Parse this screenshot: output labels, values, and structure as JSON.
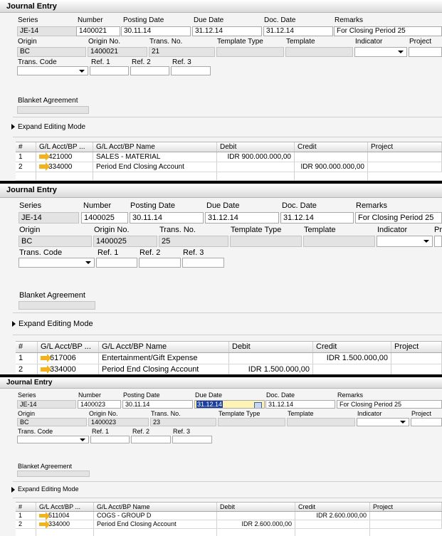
{
  "journals": [
    {
      "window_title": "Journal Entry",
      "labels": {
        "series": "Series",
        "number": "Number",
        "posting_date": "Posting Date",
        "due_date": "Due Date",
        "doc_date": "Doc. Date",
        "remarks": "Remarks",
        "origin": "Origin",
        "origin_no": "Origin No.",
        "trans_no": "Trans. No.",
        "template_type": "Template Type",
        "template": "Template",
        "indicator": "Indicator",
        "project": "Project",
        "trans_code": "Trans. Code",
        "ref1": "Ref. 1",
        "ref2": "Ref. 2",
        "ref3": "Ref. 3",
        "blanket_agreement": "Blanket Agreement"
      },
      "values": {
        "series": "JE-14",
        "number": "1400021",
        "posting_date": "30.11.14",
        "due_date": "31.12.14",
        "doc_date": "31.12.14",
        "remarks": "For Closing Period 25",
        "origin": "BC",
        "origin_no": "1400021",
        "trans_no": "21"
      },
      "expand_label": "Expand Editing Mode",
      "grid_headers": [
        "#",
        "G/L Acct/BP ...",
        "G/L Acct/BP Name",
        "Debit",
        "Credit",
        "Project"
      ],
      "rows": [
        {
          "num": "1",
          "acct": "421000",
          "name": "SALES - MATERIAL",
          "debit": "IDR 900.000.000,00",
          "credit": ""
        },
        {
          "num": "2",
          "acct": "334000",
          "name": "Period End Closing Account",
          "debit": "",
          "credit": "IDR 900.000.000,00"
        }
      ]
    },
    {
      "window_title": "Journal Entry",
      "labels": {
        "series": "Series",
        "number": "Number",
        "posting_date": "Posting Date",
        "due_date": "Due Date",
        "doc_date": "Doc. Date",
        "remarks": "Remarks",
        "origin": "Origin",
        "origin_no": "Origin No.",
        "trans_no": "Trans. No.",
        "template_type": "Template Type",
        "template": "Template",
        "indicator": "Indicator",
        "project": "Pr",
        "trans_code": "Trans. Code",
        "ref1": "Ref. 1",
        "ref2": "Ref. 2",
        "ref3": "Ref. 3",
        "blanket_agreement": "Blanket Agreement"
      },
      "values": {
        "series": "JE-14",
        "number": "1400025",
        "posting_date": "30.11.14",
        "due_date": "31.12.14",
        "doc_date": "31.12.14",
        "remarks": "For Closing Period 25",
        "origin": "BC",
        "origin_no": "1400025",
        "trans_no": "25"
      },
      "expand_label": "Expand Editing Mode",
      "grid_headers": [
        "#",
        "G/L Acct/BP ...",
        "G/L Acct/BP Name",
        "Debit",
        "Credit",
        "Project"
      ],
      "rows": [
        {
          "num": "1",
          "acct": "617006",
          "name": "Entertainment/Gift Expense",
          "debit": "",
          "credit": "IDR 1.500.000,00"
        },
        {
          "num": "2",
          "acct": "334000",
          "name": "Period End Closing Account",
          "debit": "IDR 1.500.000,00",
          "credit": ""
        }
      ]
    },
    {
      "window_title": "Journal Entry",
      "labels": {
        "series": "Series",
        "number": "Number",
        "posting_date": "Posting Date",
        "due_date": "Due Date",
        "doc_date": "Doc. Date",
        "remarks": "Remarks",
        "origin": "Origin",
        "origin_no": "Origin No.",
        "trans_no": "Trans. No.",
        "template_type": "Template Type",
        "template": "Template",
        "indicator": "Indicator",
        "project": "Project",
        "trans_code": "Trans. Code",
        "ref1": "Ref. 1",
        "ref2": "Ref. 2",
        "ref3": "Ref. 3",
        "blanket_agreement": "Blanket Agreement"
      },
      "values": {
        "series": "JE-14",
        "number": "1400023",
        "posting_date": "30.11.14",
        "due_date": "31.12.14",
        "doc_date": "31.12.14",
        "remarks": "For Closing Period 25",
        "origin": "BC",
        "origin_no": "1400023",
        "trans_no": "23"
      },
      "expand_label": "Expand Editing Mode",
      "grid_headers": [
        "#",
        "G/L Acct/BP ...",
        "G/L Acct/BP Name",
        "Debit",
        "Credit",
        "Project"
      ],
      "rows": [
        {
          "num": "1",
          "acct": "511004",
          "name": "COGS - GROUP D",
          "debit": "",
          "credit": "IDR 2.600.000,00"
        },
        {
          "num": "2",
          "acct": "334000",
          "name": "Period End Closing Account",
          "debit": "IDR 2.600.000,00",
          "credit": ""
        }
      ]
    }
  ],
  "colors": {
    "title_bar": "#dcdcdc",
    "readonly_field": "#e3e3e3",
    "due_date_focus": "#fff4b3",
    "selection": "#1b3f9e",
    "link_arrow": "#f2b21d"
  }
}
